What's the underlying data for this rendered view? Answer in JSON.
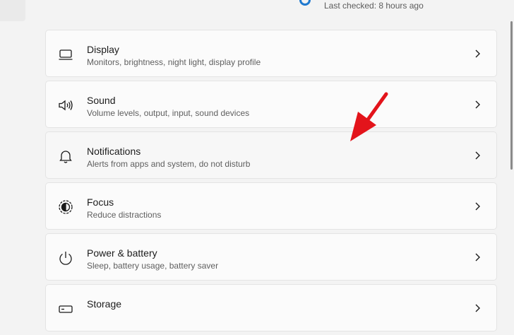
{
  "update_status": {
    "last_checked": "Last checked: 8 hours ago"
  },
  "settings_items": [
    {
      "title": "Display",
      "subtitle": "Monitors, brightness, night light, display profile",
      "icon": "monitor-icon"
    },
    {
      "title": "Sound",
      "subtitle": "Volume levels, output, input, sound devices",
      "icon": "speaker-icon"
    },
    {
      "title": "Notifications",
      "subtitle": "Alerts from apps and system, do not disturb",
      "icon": "bell-icon"
    },
    {
      "title": "Focus",
      "subtitle": "Reduce distractions",
      "icon": "focus-icon"
    },
    {
      "title": "Power & battery",
      "subtitle": "Sleep, battery usage, battery saver",
      "icon": "power-icon"
    },
    {
      "title": "Storage",
      "subtitle": "",
      "icon": "storage-icon"
    }
  ],
  "colors": {
    "background": "#f3f3f3",
    "card": "#fbfbfb",
    "arrow": "#e3141b",
    "accent": "#1f79cf"
  }
}
